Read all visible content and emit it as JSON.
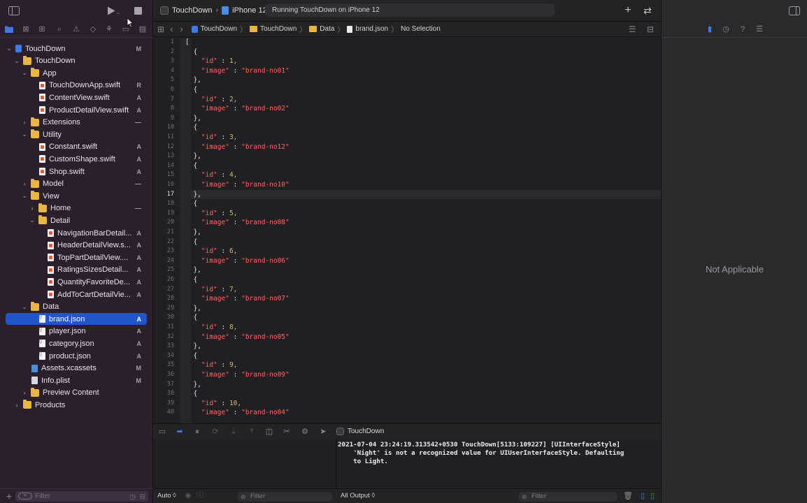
{
  "toolbar": {
    "scheme_project": "TouchDown",
    "scheme_device": "iPhone 12",
    "activity": "Running TouchDown on iPhone 12"
  },
  "jumpbar": {
    "crumbs": [
      "TouchDown",
      "TouchDown",
      "Data",
      "brand.json",
      "No Selection"
    ]
  },
  "navigator": {
    "filter_placeholder": "Filter",
    "items": [
      {
        "label": "TouchDown",
        "badge": "M"
      },
      {
        "label": "TouchDown",
        "badge": ""
      },
      {
        "label": "App",
        "badge": ""
      },
      {
        "label": "TouchDownApp.swift",
        "badge": "R"
      },
      {
        "label": "ContentView.swift",
        "badge": "A"
      },
      {
        "label": "ProductDetailView.swift",
        "badge": "A"
      },
      {
        "label": "Extensions",
        "badge": "—"
      },
      {
        "label": "Utility",
        "badge": ""
      },
      {
        "label": "Constant.swift",
        "badge": "A"
      },
      {
        "label": "CustomShape.swift",
        "badge": "A"
      },
      {
        "label": "Shop.swift",
        "badge": "A"
      },
      {
        "label": "Model",
        "badge": "—"
      },
      {
        "label": "View",
        "badge": ""
      },
      {
        "label": "Home",
        "badge": "—"
      },
      {
        "label": "Detail",
        "badge": ""
      },
      {
        "label": "NavigationBarDetail...",
        "badge": "A"
      },
      {
        "label": "HeaderDetailView.s...",
        "badge": "A"
      },
      {
        "label": "TopPartDetailView....",
        "badge": "A"
      },
      {
        "label": "RatingsSizesDetail...",
        "badge": "A"
      },
      {
        "label": "QuantityFavoriteDe...",
        "badge": "A"
      },
      {
        "label": "AddToCartDetailVie...",
        "badge": "A"
      },
      {
        "label": "Data",
        "badge": ""
      },
      {
        "label": "brand.json",
        "badge": "A"
      },
      {
        "label": "player.json",
        "badge": "A"
      },
      {
        "label": "category.json",
        "badge": "A"
      },
      {
        "label": "product.json",
        "badge": "A"
      },
      {
        "label": "Assets.xcassets",
        "badge": "M"
      },
      {
        "label": "Info.plist",
        "badge": "M"
      },
      {
        "label": "Preview Content",
        "badge": ""
      },
      {
        "label": "Products",
        "badge": ""
      }
    ]
  },
  "editor": {
    "current_line": "17",
    "lines": [
      {
        "n": "1",
        "t": "["
      },
      {
        "n": "2",
        "t": "  {"
      },
      {
        "n": "3",
        "key": "\"id\"",
        "val": "1,"
      },
      {
        "n": "4",
        "key": "\"image\"",
        "str": "\"brand-no01\""
      },
      {
        "n": "5",
        "t": "  },"
      },
      {
        "n": "6",
        "t": "  {"
      },
      {
        "n": "7",
        "key": "\"id\"",
        "val": "2,"
      },
      {
        "n": "8",
        "key": "\"image\"",
        "str": "\"brand-no02\""
      },
      {
        "n": "9",
        "t": "  },"
      },
      {
        "n": "10",
        "t": "  {"
      },
      {
        "n": "11",
        "key": "\"id\"",
        "val": "3,"
      },
      {
        "n": "12",
        "key": "\"image\"",
        "str": "\"brand-no12\""
      },
      {
        "n": "13",
        "t": "  },"
      },
      {
        "n": "14",
        "t": "  {"
      },
      {
        "n": "15",
        "key": "\"id\"",
        "val": "4,"
      },
      {
        "n": "16",
        "key": "\"image\"",
        "str": "\"brand-no10\""
      },
      {
        "n": "17",
        "t": "  },"
      },
      {
        "n": "18",
        "t": "  {"
      },
      {
        "n": "19",
        "key": "\"id\"",
        "val": "5,"
      },
      {
        "n": "20",
        "key": "\"image\"",
        "str": "\"brand-no08\""
      },
      {
        "n": "21",
        "t": "  },"
      },
      {
        "n": "22",
        "t": "  {"
      },
      {
        "n": "23",
        "key": "\"id\"",
        "val": "6,"
      },
      {
        "n": "24",
        "key": "\"image\"",
        "str": "\"brand-no06\""
      },
      {
        "n": "25",
        "t": "  },"
      },
      {
        "n": "26",
        "t": "  {"
      },
      {
        "n": "27",
        "key": "\"id\"",
        "val": "7,"
      },
      {
        "n": "28",
        "key": "\"image\"",
        "str": "\"brand-no07\""
      },
      {
        "n": "29",
        "t": "  },"
      },
      {
        "n": "30",
        "t": "  {"
      },
      {
        "n": "31",
        "key": "\"id\"",
        "val": "8,"
      },
      {
        "n": "32",
        "key": "\"image\"",
        "str": "\"brand-no05\""
      },
      {
        "n": "33",
        "t": "  },"
      },
      {
        "n": "34",
        "t": "  {"
      },
      {
        "n": "35",
        "key": "\"id\"",
        "val": "9,"
      },
      {
        "n": "36",
        "key": "\"image\"",
        "str": "\"brand-no09\""
      },
      {
        "n": "37",
        "t": "  },"
      },
      {
        "n": "38",
        "t": "  {"
      },
      {
        "n": "39",
        "key": "\"id\"",
        "val": "10,"
      },
      {
        "n": "40",
        "key": "\"image\"",
        "str": "\"brand-no04\""
      }
    ]
  },
  "debug": {
    "process": "TouchDown",
    "console_lines": [
      "2021-07-04 23:24:19.313542+0530 TouchDown[5133:109227] [UIInterfaceStyle]",
      "    'Night' is not a recognized value for UIUserInterfaceStyle. Defaulting",
      "    to Light."
    ],
    "vars_scope": "Auto ◊",
    "vars_filter_placeholder": "Filter",
    "output_scope": "All Output ◊",
    "console_filter_placeholder": "Filter"
  },
  "inspector": {
    "empty_text": "Not Applicable"
  },
  "colors": {
    "selection": "#2056c9",
    "keyword": "#fc6a5d",
    "number": "#d0bf69"
  }
}
